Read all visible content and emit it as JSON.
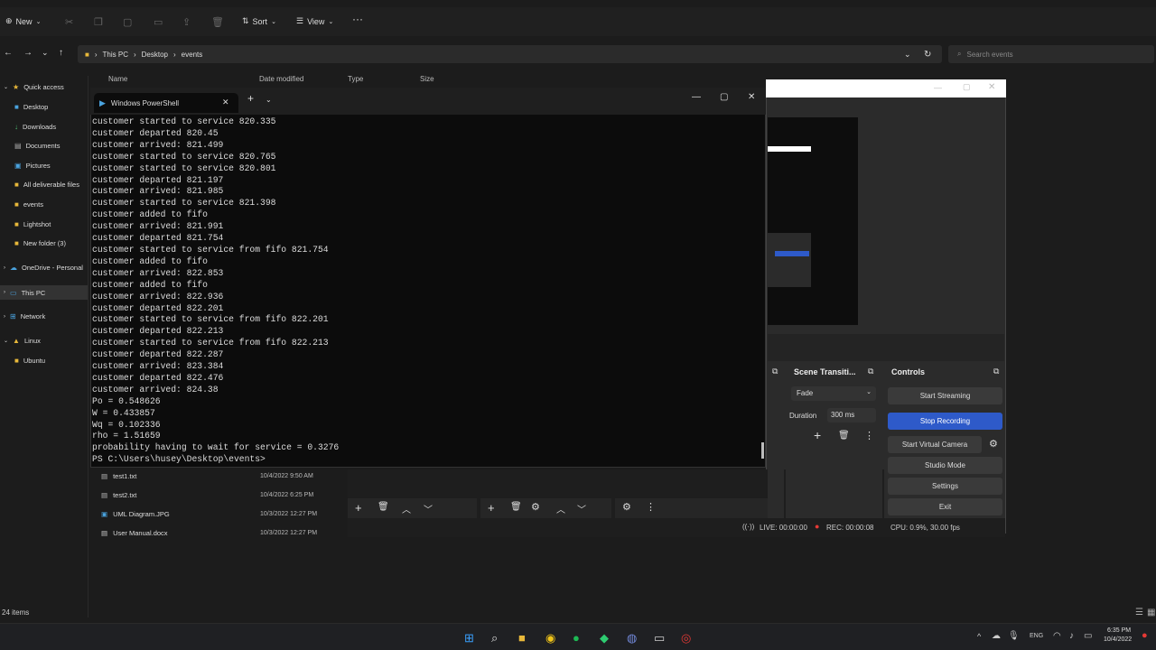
{
  "explorer": {
    "toolbar": {
      "new": "New",
      "sort": "Sort",
      "view": "View",
      "more": "···"
    },
    "breadcrumb": [
      "This PC",
      "Desktop",
      "events"
    ],
    "search_placeholder": "Search events",
    "columns": {
      "name": "Name",
      "date": "Date modified",
      "type": "Type",
      "size": "Size"
    },
    "sidebar": [
      "Quick access",
      "Desktop",
      "Downloads",
      "Documents",
      "Pictures",
      "All deliverable files",
      "events",
      "Lightshot",
      "New folder (3)",
      "OneDrive - Personal",
      "This PC",
      "Network",
      "Linux",
      "Ubuntu"
    ],
    "files": [
      {
        "name": "test1.txt",
        "date": "10/4/2022 9:50 AM"
      },
      {
        "name": "test2.txt",
        "date": "10/4/2022 6:25 PM"
      },
      {
        "name": "UML Diagram.JPG",
        "date": "10/3/2022 12:27 PM"
      },
      {
        "name": "User Manual.docx",
        "date": "10/3/2022 12:27 PM"
      }
    ],
    "status": "24 items"
  },
  "powershell": {
    "tab_title": "Windows PowerShell",
    "lines": [
      "customer started to service 820.335",
      "customer departed 820.45",
      "customer arrived: 821.499",
      "customer started to service 820.765",
      "customer started to service 820.801",
      "customer departed 821.197",
      "customer arrived: 821.985",
      "customer started to service 821.398",
      "customer added to fifo",
      "customer arrived: 821.991",
      "customer departed 821.754",
      "customer started to service from fifo 821.754",
      "customer added to fifo",
      "customer arrived: 822.853",
      "customer added to fifo",
      "customer arrived: 822.936",
      "customer departed 822.201",
      "customer started to service from fifo 822.201",
      "customer departed 822.213",
      "customer started to service from fifo 822.213",
      "customer departed 822.287",
      "customer arrived: 823.384",
      "customer departed 822.476",
      "customer arrived: 824.38",
      "Po = 0.548626",
      "W = 0.433857",
      "Wq = 0.102336",
      "rho = 1.51659",
      "probability having to wait for service = 0.3276",
      "PS C:\\Users\\husey\\Desktop\\events>"
    ]
  },
  "obs": {
    "scene_transitions": "Scene Transiti...",
    "transition": "Fade",
    "duration_label": "Duration",
    "duration_value": "300 ms",
    "controls": "Controls",
    "buttons": [
      "Start Streaming",
      "Stop Recording",
      "Start Virtual Camera",
      "Studio Mode",
      "Settings",
      "Exit"
    ],
    "status": {
      "live": "LIVE: 00:00:00",
      "rec": "REC: 00:00:08",
      "cpu": "CPU: 0.9%, 30.00 fps"
    }
  },
  "taskbar": {
    "lang": "ENG",
    "time": "6:35 PM",
    "date": "10/4/2022"
  },
  "colors": {
    "accent": "#2e5ac9",
    "folder": "#e8b83a",
    "rec": "#e53935"
  }
}
